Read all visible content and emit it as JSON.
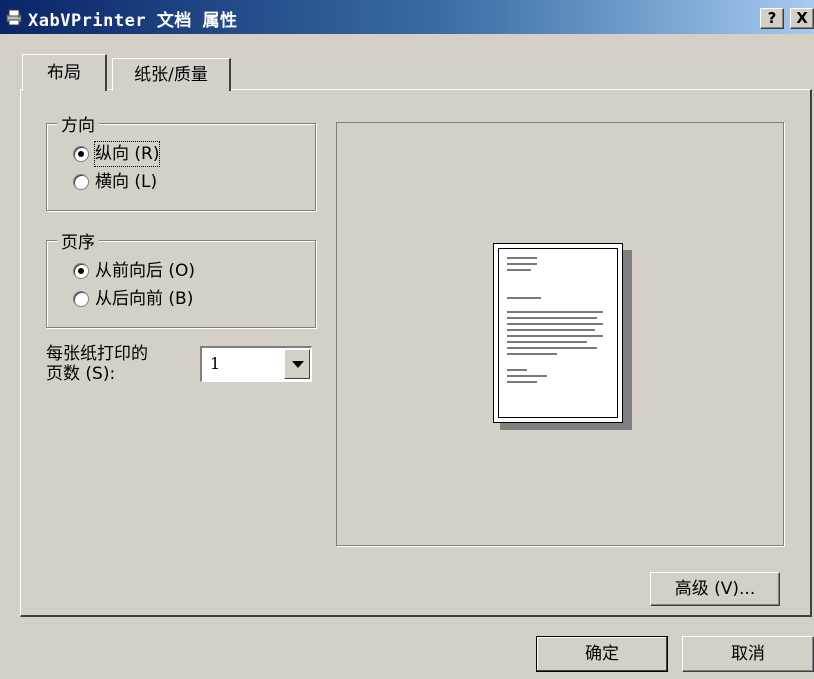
{
  "window": {
    "title": "XabVPrinter 文档 属性",
    "help_label": "?",
    "close_label": "X"
  },
  "tabs": [
    {
      "label": "布局",
      "active": true
    },
    {
      "label": "纸张/质量",
      "active": false
    }
  ],
  "orientation": {
    "title": "方向",
    "options": [
      {
        "label": "纵向 (R)",
        "selected": true
      },
      {
        "label": "横向 (L)",
        "selected": false
      }
    ]
  },
  "page_order": {
    "title": "页序",
    "options": [
      {
        "label": "从前向后 (O)",
        "selected": true
      },
      {
        "label": "从后向前 (B)",
        "selected": false
      }
    ]
  },
  "pages_per_sheet": {
    "label_line1": "每张纸打印的",
    "label_line2": "页数 (S):",
    "value": "1"
  },
  "buttons": {
    "advanced": "高级 (V)...",
    "ok": "确定",
    "cancel": "取消"
  },
  "colors": {
    "face": "#d4d0c8",
    "title_start": "#0a246a",
    "title_end": "#a6caf0"
  }
}
